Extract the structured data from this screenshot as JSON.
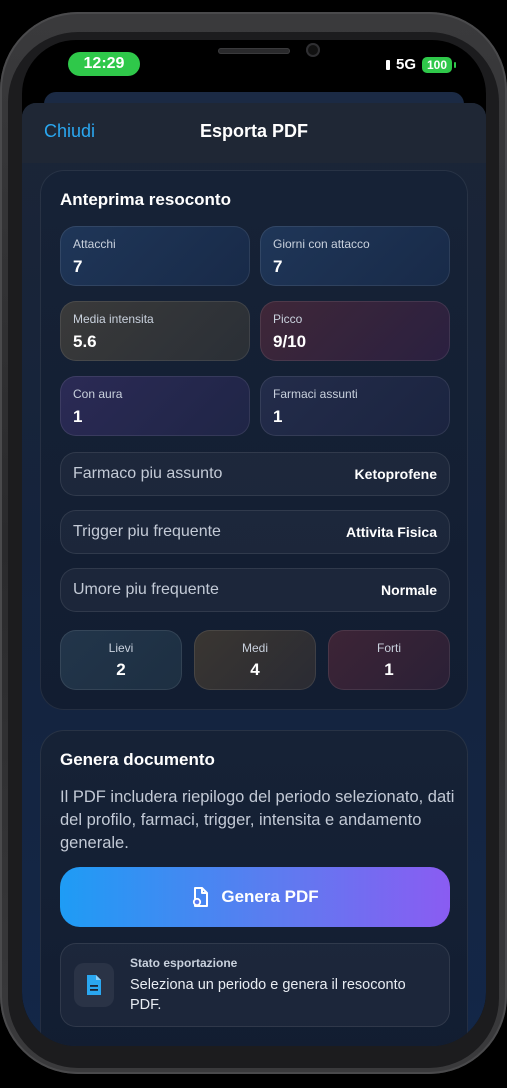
{
  "status_bar": {
    "time": "12:29",
    "network": "5G",
    "battery": "100"
  },
  "header": {
    "close_label": "Chiudi",
    "title": "Esporta PDF"
  },
  "preview": {
    "title": "Anteprima resoconto",
    "stats": [
      {
        "label": "Attacchi",
        "value": "7"
      },
      {
        "label": "Giorni con attacco",
        "value": "7"
      },
      {
        "label": "Media intensita",
        "value": "5.6"
      },
      {
        "label": "Picco",
        "value": "9/10"
      },
      {
        "label": "Con aura",
        "value": "1"
      },
      {
        "label": "Farmaci assunti",
        "value": "1"
      }
    ],
    "rows": [
      {
        "label": "Farmaco piu assunto",
        "value": "Ketoprofene"
      },
      {
        "label": "Trigger piu frequente",
        "value": "Attivita Fisica"
      },
      {
        "label": "Umore piu frequente",
        "value": "Normale"
      }
    ],
    "severity": [
      {
        "label": "Lievi",
        "value": "2"
      },
      {
        "label": "Medi",
        "value": "4"
      },
      {
        "label": "Forti",
        "value": "1"
      }
    ]
  },
  "generate": {
    "title": "Genera documento",
    "description": "Il PDF includera riepilogo del periodo selezionato, dati del profilo, farmaci, trigger, intensita e andamento generale.",
    "button_label": "Genera PDF",
    "status_label": "Stato esportazione",
    "status_text": "Seleziona un periodo e genera il resoconto PDF."
  },
  "colors": {
    "accent": "#2aa7f0",
    "button_gradient_start": "#1e9cf5",
    "button_gradient_end": "#8a5cf2",
    "time_pill": "#2fc84a"
  }
}
